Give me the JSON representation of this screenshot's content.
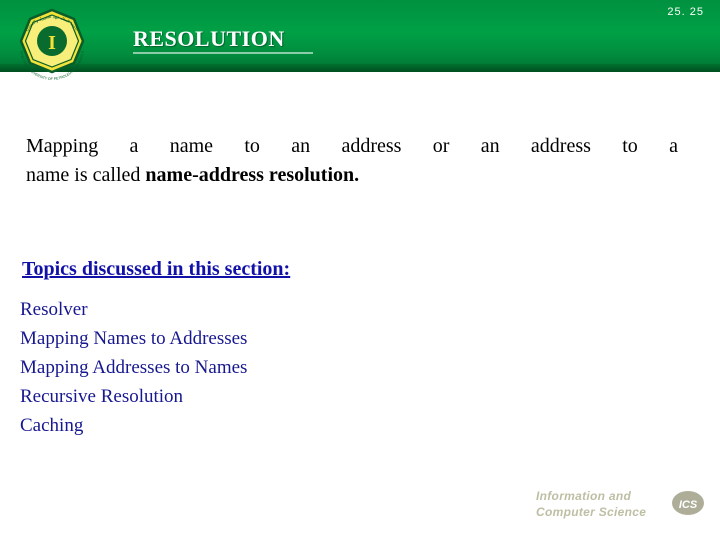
{
  "slide": {
    "number": "25. 25",
    "title": "RESOLUTION",
    "statement_line1": "Mapping a name to an address or an address to a",
    "statement_line2_prefix": "name is called ",
    "statement_line2_bold": "name-address resolution.",
    "topics_heading": "Topics discussed in this section:",
    "topics": [
      "Resolver",
      "Mapping Names to Addresses",
      "Mapping Addresses to Names",
      "Recursive Resolution",
      "Caching"
    ],
    "colors": {
      "header_green": "#00a046",
      "header_green_dark": "#006e2f",
      "topic_blue": "#17178f",
      "heading_blue": "#1111a8"
    }
  },
  "logo": {
    "top_arc_text": "جامعة الملك فهد للبترول والمعادن",
    "bottom_arc_text": "KING FAHD UNIVERSITY OF PETROLEUM & MINERALS",
    "letter": "I"
  },
  "footer": {
    "line1": "Information and",
    "line2": "Computer Science",
    "badge": "ICS"
  }
}
